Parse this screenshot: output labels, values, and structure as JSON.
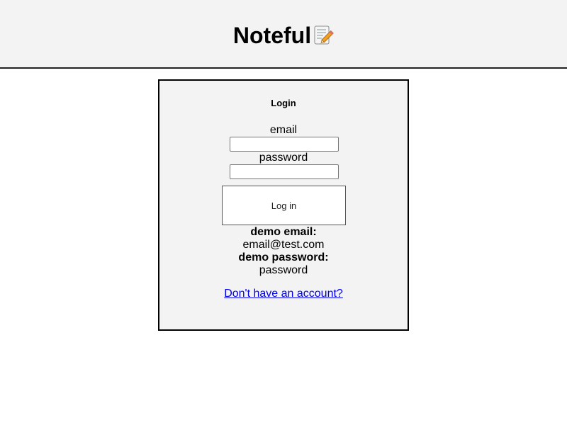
{
  "header": {
    "title": "Noteful",
    "icon": "memo-pencil-icon"
  },
  "login": {
    "heading": "Login",
    "email_label": "email",
    "email_value": "",
    "password_label": "password",
    "password_value": "",
    "submit_label": "Log in",
    "demo_email_label": "demo email:",
    "demo_email_value": "email@test.com",
    "demo_password_label": "demo password:",
    "demo_password_value": "password",
    "signup_link": "Don't have an account?"
  }
}
